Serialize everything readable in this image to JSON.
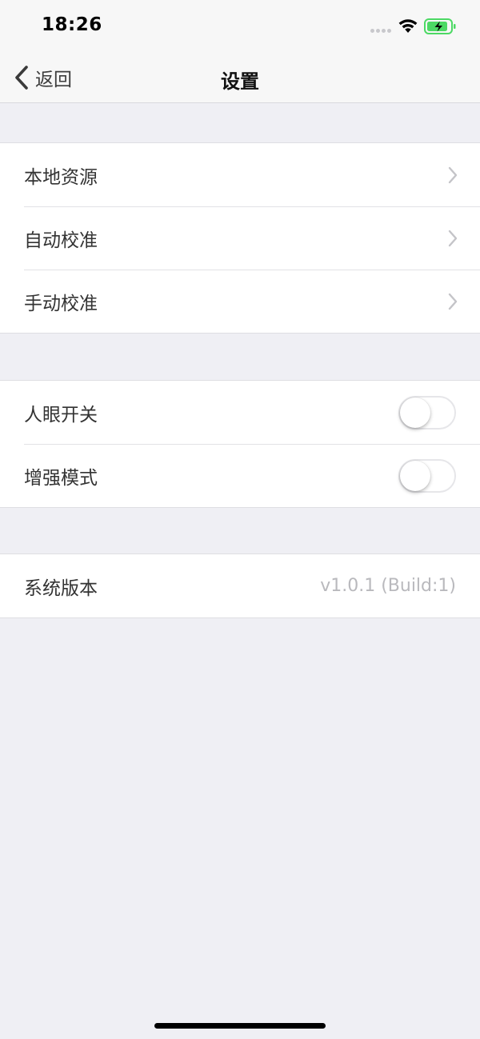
{
  "status_bar": {
    "time": "18:26",
    "icons": [
      "cellular-signal-icon",
      "wifi-icon",
      "battery-charging-icon"
    ],
    "battery_color": "#4cd964"
  },
  "nav": {
    "back_label": "返回",
    "title": "设置"
  },
  "sections": {
    "resources": {
      "items": [
        {
          "label": "本地资源"
        },
        {
          "label": "自动校准"
        },
        {
          "label": "手动校准"
        }
      ]
    },
    "switches": {
      "items": [
        {
          "label": "人眼开关",
          "on": false
        },
        {
          "label": "增强模式",
          "on": false
        }
      ]
    },
    "about": {
      "version_label": "系统版本",
      "version_value": "v1.0.1 (Build:1)"
    }
  },
  "colors": {
    "background": "#efeff4",
    "cell": "#ffffff",
    "text": "#333333",
    "secondary_text": "#b9b9bd"
  }
}
